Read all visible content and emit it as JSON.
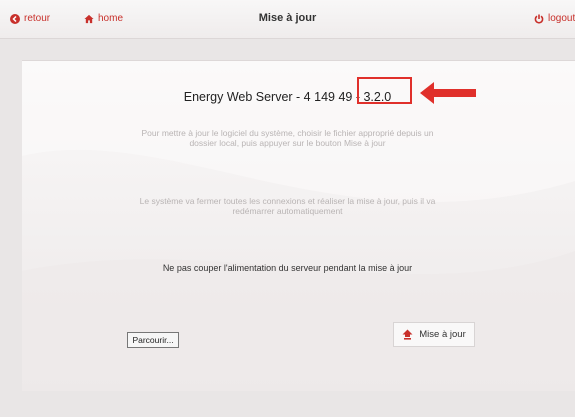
{
  "header": {
    "back_label": "retour",
    "home_label": "home",
    "title": "Mise à jour",
    "logout_label": "logout"
  },
  "main": {
    "server_label": "Energy Web Server - 4 149 49 - 3.2.0",
    "info_update_line1": "Pour mettre à jour le logiciel du système, choisir le fichier approprié depuis un",
    "info_update_line2": "dossier local, puis appuyer sur le bouton Mise à jour",
    "info_restart_line1": "Le système va fermer toutes les connexions et réaliser la mise à jour, puis il va",
    "info_restart_line2": "redémarrer automatiquement",
    "warning": "Ne pas couper l'alimentation du serveur pendant la mise à jour",
    "browse_label": "Parcourir...",
    "update_button_label": "Mise à jour"
  },
  "icons": {
    "back": "back-circle-icon",
    "home": "home-icon",
    "logout": "power-icon",
    "upload": "upload-house-icon",
    "annotation": "red-arrow"
  },
  "colors": {
    "accent": "#c8302b",
    "annotation": "#e0302b",
    "background": "#e9e6e6"
  }
}
